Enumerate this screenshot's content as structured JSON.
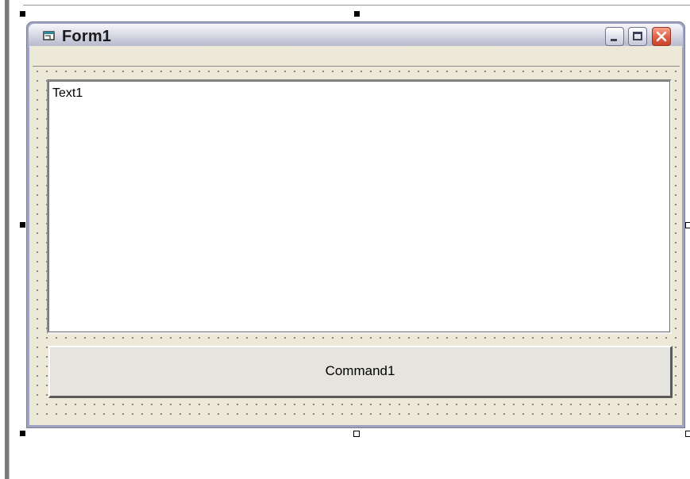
{
  "window": {
    "title": "Form1",
    "icon": "form-icon",
    "buttons": {
      "minimize": "minimize-icon",
      "maximize": "maximize-icon",
      "close": "close-icon"
    }
  },
  "controls": {
    "textbox": {
      "value": "Text1"
    },
    "command_button": {
      "label": "Command1"
    }
  },
  "colors": {
    "titlebar": "#c3c5d6",
    "close_button": "#e3624a",
    "client": "#ece9d8",
    "textbox": "#ffffff",
    "button": "#e6e4df"
  }
}
